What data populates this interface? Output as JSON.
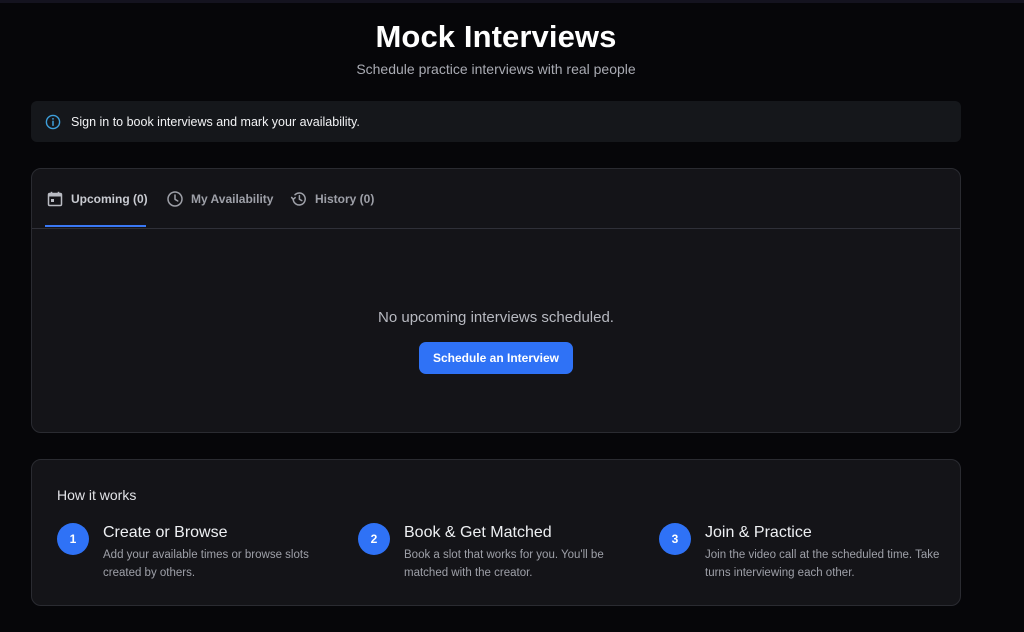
{
  "header": {
    "title": "Mock Interviews",
    "subtitle": "Schedule practice interviews with real people"
  },
  "alert": {
    "icon": "info-icon",
    "text": "Sign in to book interviews and mark your availability.",
    "color": "#3ea0dc"
  },
  "tabs": [
    {
      "label": "Upcoming (0)",
      "icon": "calendar-icon",
      "active": true
    },
    {
      "label": "My Availability",
      "icon": "clock-icon",
      "active": false
    },
    {
      "label": "History (0)",
      "icon": "history-icon",
      "active": false
    }
  ],
  "upcoming": {
    "empty_text": "No upcoming interviews scheduled.",
    "button_label": "Schedule an Interview"
  },
  "how_it_works": {
    "title": "How it works",
    "steps": [
      {
        "number": "1",
        "title": "Create or Browse",
        "description": "Add your available times or browse slots created by others."
      },
      {
        "number": "2",
        "title": "Book & Get Matched",
        "description": "Book a slot that works for you. You'll be matched with the creator."
      },
      {
        "number": "3",
        "title": "Join & Practice",
        "description": "Join the video call at the scheduled time. Take turns interviewing each other."
      }
    ]
  },
  "colors": {
    "accent": "#2f72f6",
    "background": "#060609",
    "card": "#141418"
  }
}
